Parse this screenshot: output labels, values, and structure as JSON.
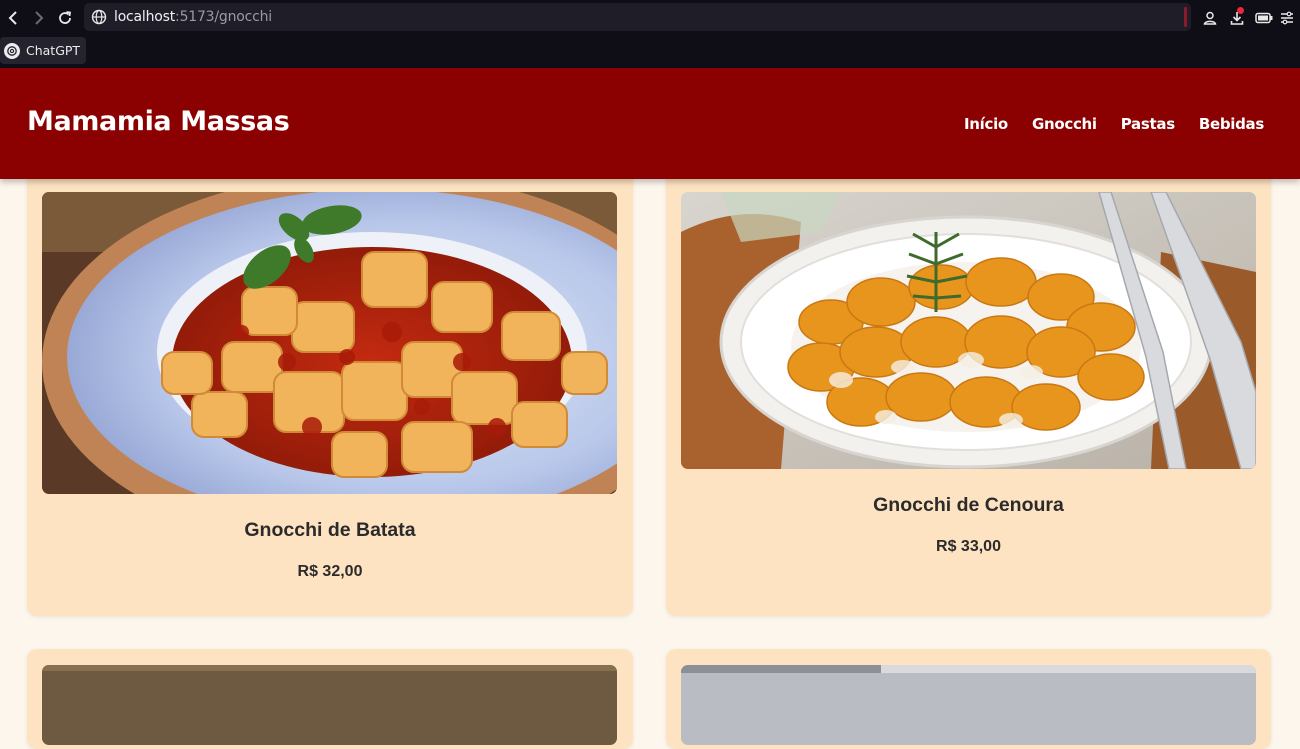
{
  "browser": {
    "url_host": "localhost",
    "url_path": ":5173/gnocchi",
    "bookmark_label": "ChatGPT",
    "icons": [
      "back-icon",
      "forward-icon",
      "reload-icon",
      "globe-icon",
      "profile-icon",
      "download-icon",
      "battery-icon",
      "menu-icon"
    ]
  },
  "header": {
    "logo": "Mamamia Massas",
    "nav": [
      "Início",
      "Gnocchi",
      "Pastas",
      "Bebidas"
    ]
  },
  "products": [
    {
      "title": "Gnocchi de Batata",
      "price": "R$ 32,00"
    },
    {
      "title": "Gnocchi de Cenoura",
      "price": "R$ 33,00"
    }
  ],
  "colors": {
    "header_bg": "#8b0000",
    "page_bg": "#fdf6ec",
    "card_bg": "#fde3c1"
  }
}
